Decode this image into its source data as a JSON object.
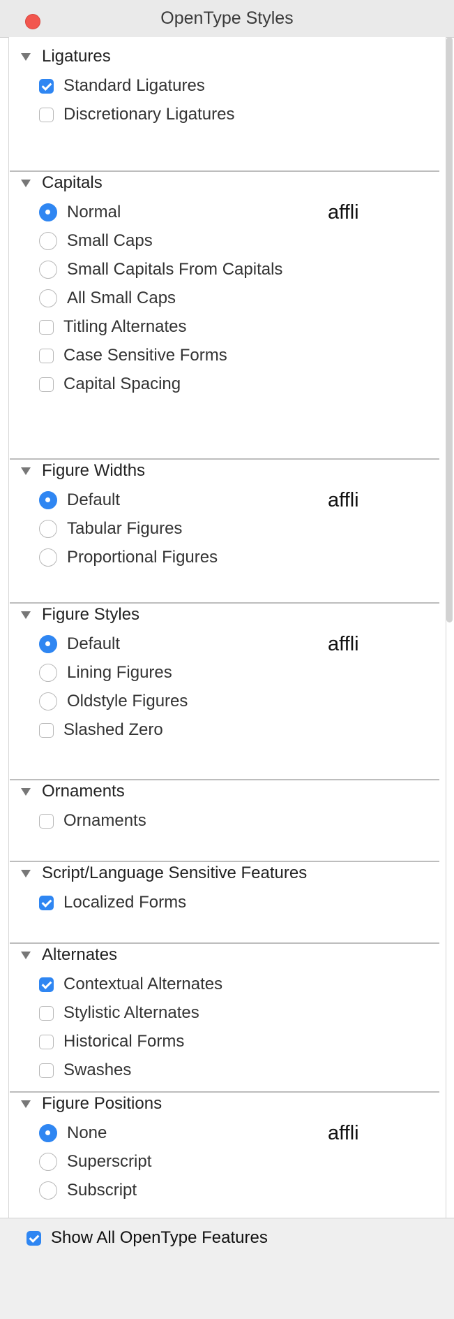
{
  "window": {
    "title": "OpenType Styles"
  },
  "sections": [
    {
      "title": "Ligatures",
      "sample": "",
      "options": [
        {
          "type": "checkbox",
          "label": "Standard Ligatures",
          "checked": true
        },
        {
          "type": "checkbox",
          "label": "Discretionary Ligatures",
          "checked": false
        }
      ]
    },
    {
      "title": "Capitals",
      "sample": "affli",
      "options": [
        {
          "type": "radio",
          "label": "Normal",
          "checked": true
        },
        {
          "type": "radio",
          "label": "Small Caps",
          "checked": false
        },
        {
          "type": "radio",
          "label": "Small Capitals From Capitals",
          "checked": false
        },
        {
          "type": "radio",
          "label": "All Small Caps",
          "checked": false
        },
        {
          "type": "checkbox",
          "label": "Titling Alternates",
          "checked": false
        },
        {
          "type": "checkbox",
          "label": "Case Sensitive Forms",
          "checked": false
        },
        {
          "type": "checkbox",
          "label": "Capital Spacing",
          "checked": false
        }
      ]
    },
    {
      "title": "Figure Widths",
      "sample": "affli",
      "options": [
        {
          "type": "radio",
          "label": "Default",
          "checked": true
        },
        {
          "type": "radio",
          "label": "Tabular Figures",
          "checked": false
        },
        {
          "type": "radio",
          "label": "Proportional Figures",
          "checked": false
        }
      ]
    },
    {
      "title": "Figure Styles",
      "sample": "affli",
      "options": [
        {
          "type": "radio",
          "label": "Default",
          "checked": true
        },
        {
          "type": "radio",
          "label": "Lining Figures",
          "checked": false
        },
        {
          "type": "radio",
          "label": "Oldstyle Figures",
          "checked": false
        },
        {
          "type": "checkbox",
          "label": "Slashed Zero",
          "checked": false
        }
      ]
    },
    {
      "title": "Ornaments",
      "sample": "",
      "options": [
        {
          "type": "checkbox",
          "label": "Ornaments",
          "checked": false
        }
      ]
    },
    {
      "title": "Script/Language Sensitive Features",
      "sample": "",
      "options": [
        {
          "type": "checkbox",
          "label": "Localized Forms",
          "checked": true
        }
      ]
    },
    {
      "title": "Alternates",
      "sample": "",
      "options": [
        {
          "type": "checkbox",
          "label": "Contextual Alternates",
          "checked": true
        },
        {
          "type": "checkbox",
          "label": "Stylistic Alternates",
          "checked": false
        },
        {
          "type": "checkbox",
          "label": "Historical Forms",
          "checked": false
        },
        {
          "type": "checkbox",
          "label": "Swashes",
          "checked": false
        }
      ]
    },
    {
      "title": "Figure Positions",
      "sample": "affli",
      "options": [
        {
          "type": "radio",
          "label": "None",
          "checked": true
        },
        {
          "type": "radio",
          "label": "Superscript",
          "checked": false
        },
        {
          "type": "radio",
          "label": "Subscript",
          "checked": false
        }
      ]
    }
  ],
  "footer": {
    "label": "Show All OpenType Features",
    "checked": true
  },
  "colors": {
    "accent": "#2f86f2",
    "close": "#f2564e"
  }
}
